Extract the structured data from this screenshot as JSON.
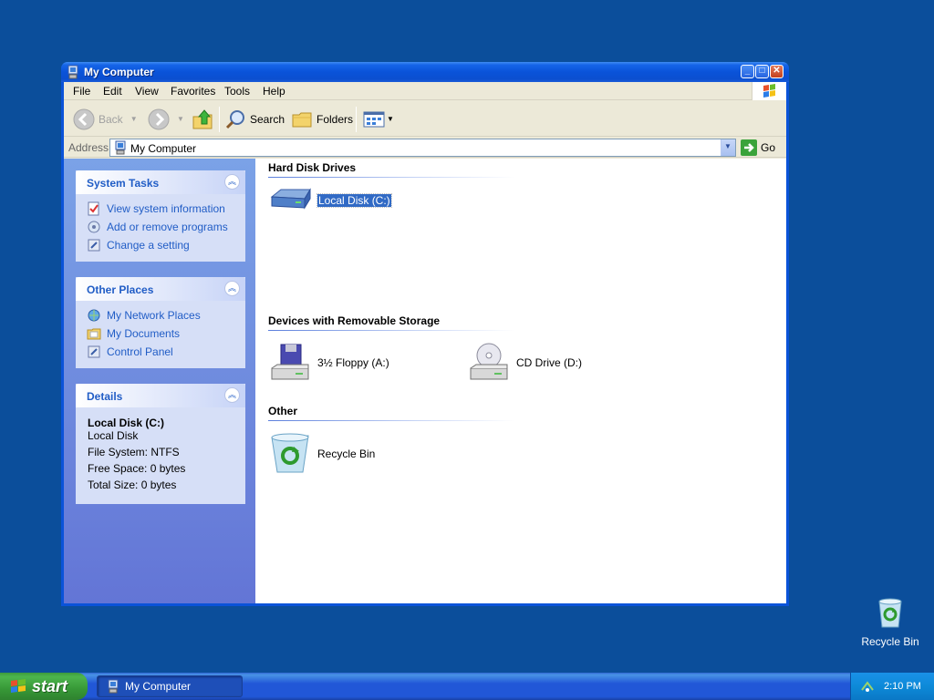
{
  "desktop": {
    "recycle_bin_label": "Recycle Bin"
  },
  "window": {
    "title": "My Computer",
    "menu": [
      "File",
      "Edit",
      "View",
      "Favorites",
      "Tools",
      "Help"
    ],
    "toolbar": {
      "back": "Back",
      "search": "Search",
      "folders": "Folders"
    },
    "address": {
      "label": "Address",
      "value": "My Computer",
      "go": "Go"
    }
  },
  "sidebar": {
    "system_tasks": {
      "title": "System Tasks",
      "items": [
        "View system information",
        "Add or remove programs",
        "Change a setting"
      ]
    },
    "other_places": {
      "title": "Other Places",
      "items": [
        "My Network Places",
        "My Documents",
        "Control Panel"
      ]
    },
    "details": {
      "title": "Details",
      "name": "Local Disk (C:)",
      "type": "Local Disk",
      "file_system": "File System: NTFS",
      "free_space": "Free Space: 0 bytes",
      "total_size": "Total Size: 0 bytes"
    }
  },
  "content": {
    "groups": [
      {
        "title": "Hard Disk Drives",
        "items": [
          "Local Disk (C:)"
        ]
      },
      {
        "title": "Devices with Removable Storage",
        "items": [
          "3½ Floppy (A:)",
          "CD Drive (D:)"
        ]
      },
      {
        "title": "Other",
        "items": [
          "Recycle Bin"
        ]
      }
    ]
  },
  "taskbar": {
    "start_label": "start",
    "task": "My Computer",
    "clock": "2:10 PM"
  },
  "colors": {
    "desktop": "#0b4e9b",
    "titlebar": "#0a53d9",
    "link": "#215dc6",
    "selection": "#316ac5"
  }
}
